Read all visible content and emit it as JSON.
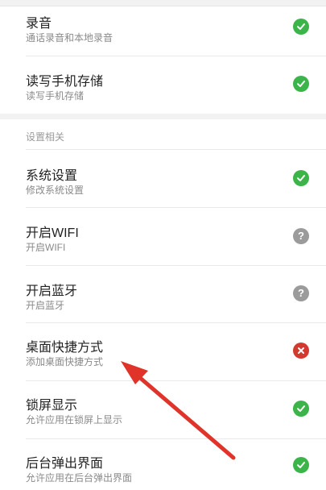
{
  "permissions": {
    "items": [
      {
        "title": "录音",
        "subtitle": "通话录音和本地录音",
        "status": "allowed",
        "icon": "check-icon"
      },
      {
        "title": "读写手机存储",
        "subtitle": "读写手机存储",
        "status": "allowed",
        "icon": "check-icon"
      }
    ]
  },
  "settings_section": {
    "header": "设置相关",
    "items": [
      {
        "title": "系统设置",
        "subtitle": "修改系统设置",
        "status": "allowed",
        "icon": "check-icon"
      },
      {
        "title": "开启WIFI",
        "subtitle": "开启WIFI",
        "status": "ask",
        "icon": "question-icon"
      },
      {
        "title": "开启蓝牙",
        "subtitle": "开启蓝牙",
        "status": "ask",
        "icon": "question-icon"
      },
      {
        "title": "桌面快捷方式",
        "subtitle": "添加桌面快捷方式",
        "status": "denied",
        "icon": "cross-icon"
      },
      {
        "title": "锁屏显示",
        "subtitle": "允许应用在锁屏上显示",
        "status": "allowed",
        "icon": "check-icon"
      },
      {
        "title": "后台弹出界面",
        "subtitle": "允许应用在后台弹出界面",
        "status": "allowed",
        "icon": "check-icon"
      }
    ]
  },
  "colors": {
    "allowed": "#3bb44a",
    "ask": "#9b9b9b",
    "denied": "#d23a2f",
    "annotation_arrow": "#e0332a"
  },
  "question_glyph": "?"
}
